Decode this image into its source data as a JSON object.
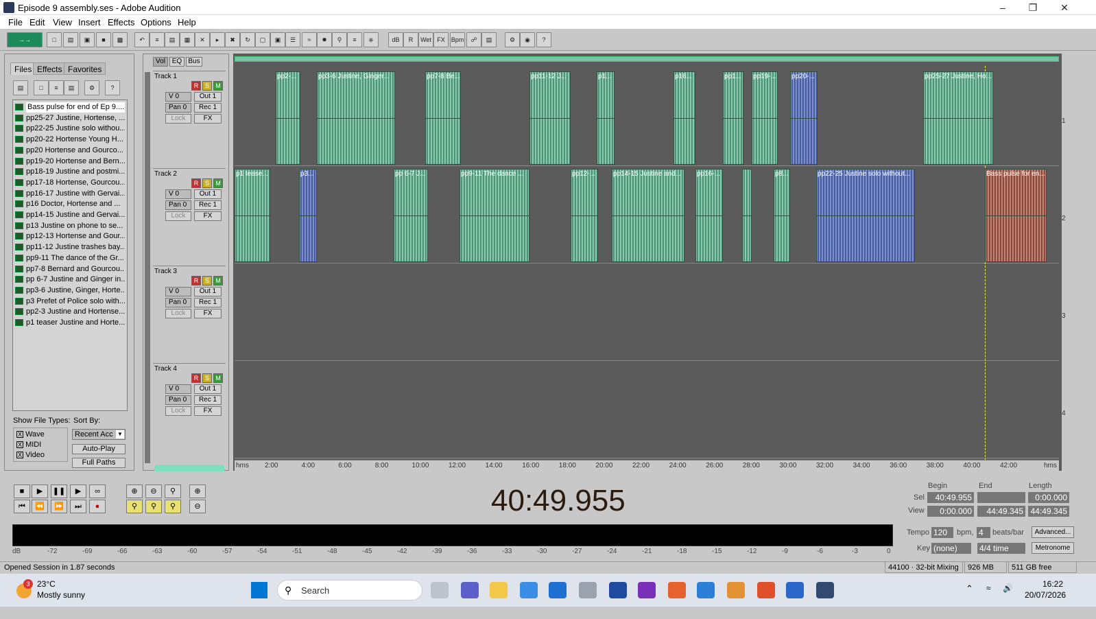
{
  "window": {
    "title": "Episode 9 assembly.ses - Adobe Audition"
  },
  "menu": [
    "File",
    "Edit",
    "View",
    "Insert",
    "Effects",
    "Options",
    "Help"
  ],
  "panel": {
    "tabs": [
      "Files",
      "Effects",
      "Favorites"
    ],
    "files": [
      "Bass pulse for end of Ep 9....",
      "pp25-27 Justine, Hortense, ...",
      "pp22-25 Justine solo withou...",
      "pp20-22 Hortense Young H...",
      "pp20 Hortense and Gourco...",
      "pp19-20 Hortense and Bern...",
      "pp18-19 Justine and postmi...",
      "pp17-18 Hortense, Gourcou...",
      "pp16-17 Justine with Gervai...",
      "p16 Doctor, Hortense and ...",
      "pp14-15 Justine and Gervai...",
      "p13 Justine on phone to se...",
      "pp12-13 Hortense and Gour...",
      "pp11-12 Justine trashes bay...",
      "pp9-11 The dance of the Gr...",
      "pp7-8 Bernard and Gourcou...",
      "pp 6-7 Justine and Ginger in...",
      "pp3-6 Justine, Ginger, Horte...",
      "p3 Prefet of Police solo with...",
      "pp2-3 Justine and Hortense...",
      "p1 teaser Justine and Horte..."
    ],
    "show_file_types_label": "Show File Types:",
    "sort_by_label": "Sort By:",
    "types": [
      "Wave",
      "MIDI",
      "Video"
    ],
    "sort_value": "Recent Acc",
    "autoplay": "Auto-Play",
    "fullpaths": "Full Paths"
  },
  "trackheader_tabs": [
    "Vol",
    "EQ",
    "Bus"
  ],
  "tracks": [
    {
      "name": "Track 1",
      "vol": "V 0",
      "pan": "Pan 0",
      "out": "Out 1",
      "rec": "Rec 1",
      "lock": "Lock",
      "fx": "FX",
      "num": "1"
    },
    {
      "name": "Track 2",
      "vol": "V 0",
      "pan": "Pan 0",
      "out": "Out 1",
      "rec": "Rec 1",
      "lock": "Lock",
      "fx": "FX",
      "num": "2"
    },
    {
      "name": "Track 3",
      "vol": "V 0",
      "pan": "Pan 0",
      "out": "Out 1",
      "rec": "Rec 1",
      "lock": "Lock",
      "fx": "FX",
      "num": "3"
    },
    {
      "name": "Track 4",
      "vol": "V 0",
      "pan": "Pan 0",
      "out": "Out 1",
      "rec": "Rec 1",
      "lock": "Lock",
      "fx": "FX",
      "num": "4"
    }
  ],
  "clips_track1": [
    "pp2-...",
    "pp3-6 Justine, Ginger...",
    "pp7-8 Be...",
    "pp11-12 J...",
    "p1...",
    "p16...",
    "pp1...",
    "pp19-...",
    "pp20-...",
    "pp25-27 Justine, Ho..."
  ],
  "clips_track2": [
    "p1 tease...",
    "p3...",
    "pp 6-7 J...",
    "pp9-11 The dance ...",
    "pp12-...",
    "pp14-15 Justine and...",
    "pp16-...",
    "",
    "p8...",
    "pp22-25 Justine solo without...",
    "Bass pulse for en..."
  ],
  "ruler": [
    "hms",
    "2:00",
    "4:00",
    "6:00",
    "8:00",
    "10:00",
    "12:00",
    "14:00",
    "16:00",
    "18:00",
    "20:00",
    "22:00",
    "24:00",
    "26:00",
    "28:00",
    "30:00",
    "32:00",
    "34:00",
    "36:00",
    "38:00",
    "40:00",
    "42:00",
    "hms"
  ],
  "timecode": "40:49.955",
  "selection": {
    "begin_label": "Begin",
    "end_label": "End",
    "length_label": "Length",
    "sel_label": "Sel",
    "view_label": "View",
    "sel_begin": "40:49.955",
    "sel_end": "",
    "sel_length": "0:00.000",
    "view_begin": "0:00.000",
    "view_end": "44:49.345",
    "view_length": "44:49.345"
  },
  "tempo": {
    "tempo_label": "Tempo",
    "tempo": "120",
    "bpm": "bpm,",
    "beats": "4",
    "beats_label": "beats/bar",
    "advanced": "Advanced...",
    "key_label": "Key",
    "key": "(none)",
    "time": "4/4 time",
    "metronome": "Metronome"
  },
  "meter_labels": [
    "dB",
    "-72",
    "-69",
    "-66",
    "-63",
    "-60",
    "-57",
    "-54",
    "-51",
    "-48",
    "-45",
    "-42",
    "-39",
    "-36",
    "-33",
    "-30",
    "-27",
    "-24",
    "-21",
    "-18",
    "-15",
    "-12",
    "-9",
    "-6",
    "-3",
    "0"
  ],
  "status": {
    "message": "Opened Session in 1.87 seconds",
    "format": "44100 · 32-bit Mixing",
    "mem": "926 MB",
    "disk": "511 GB free"
  },
  "taskbar": {
    "temp": "23°C",
    "weather": "Mostly sunny",
    "badge": "3",
    "search": "Search",
    "time": "16:22",
    "date": "20/07/2026"
  }
}
